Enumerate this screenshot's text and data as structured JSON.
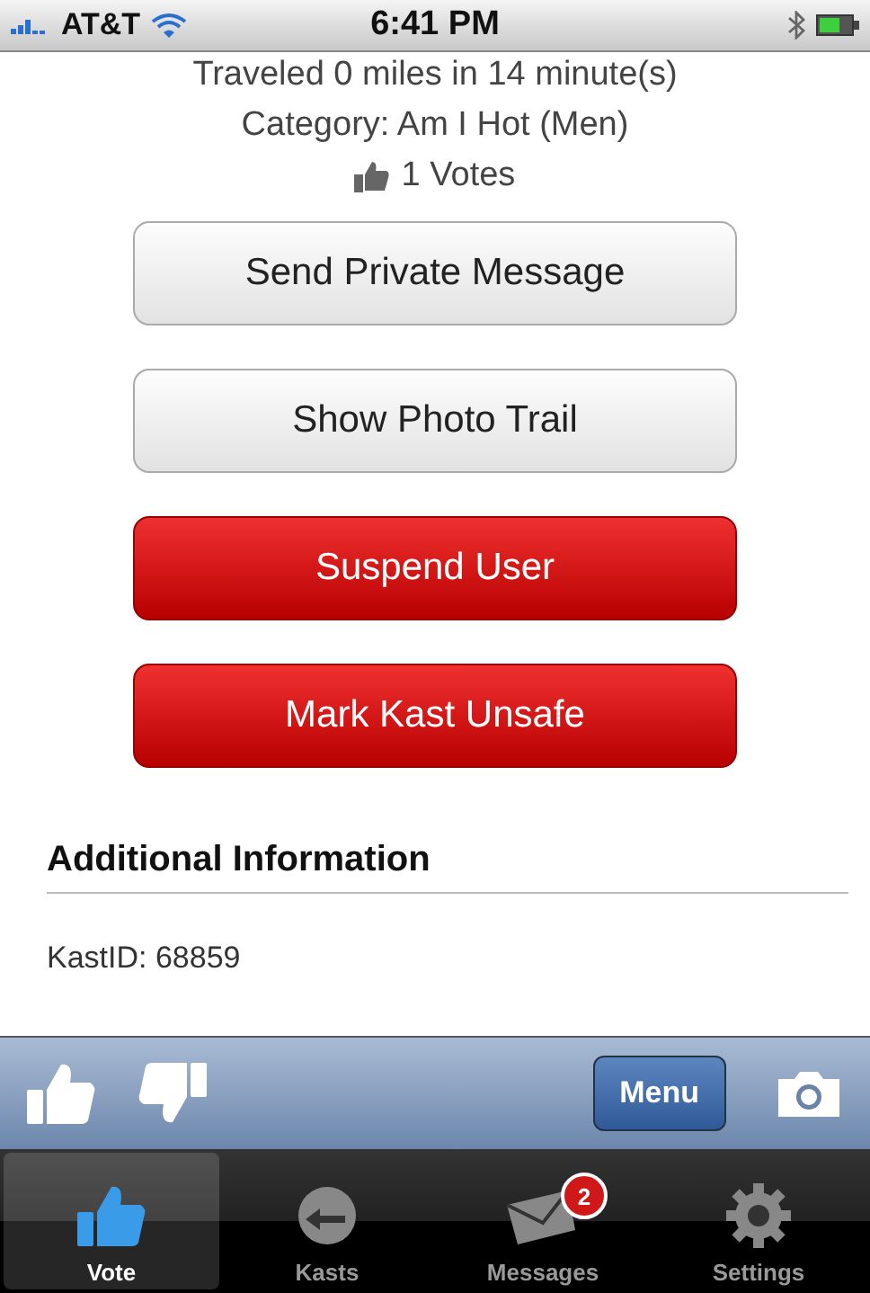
{
  "status_bar": {
    "carrier": "AT&T",
    "time": "6:41 PM"
  },
  "details": {
    "travel": "Traveled 0 miles in 14 minute(s)",
    "category": "Category: Am I Hot (Men)",
    "votes": "1 Votes"
  },
  "buttons": [
    {
      "label": "Send Private Message",
      "kind": "normal"
    },
    {
      "label": "Show Photo Trail",
      "kind": "normal"
    },
    {
      "label": "Suspend User",
      "kind": "danger"
    },
    {
      "label": "Mark Kast Unsafe",
      "kind": "danger"
    }
  ],
  "additional": {
    "heading": "Additional Information",
    "kast_id": "KastID: 68859"
  },
  "toolbar": {
    "menu": "Menu"
  },
  "tabs": [
    {
      "label": "Vote",
      "kind": "vote",
      "selected": true
    },
    {
      "label": "Kasts",
      "kind": "kasts",
      "selected": false
    },
    {
      "label": "Messages",
      "kind": "messages",
      "selected": false,
      "badge": "2"
    },
    {
      "label": "Settings",
      "kind": "settings",
      "selected": false
    }
  ]
}
